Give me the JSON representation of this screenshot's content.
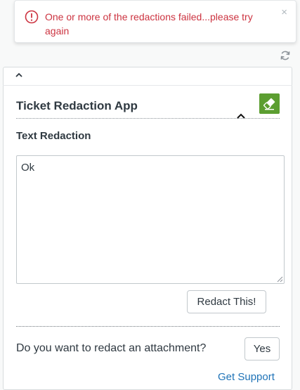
{
  "toast": {
    "message": "One or more of the redactions failed...please try again",
    "icon": "error-circle-icon",
    "close_glyph": "×",
    "color": "#cc3340"
  },
  "app": {
    "title": "Ticket Redaction App",
    "logo_icon": "eraser-icon",
    "logo_color": "#5c9e31"
  },
  "text_redaction": {
    "label": "Text Redaction",
    "value": "Ok",
    "button_label": "Redact This!"
  },
  "attachment": {
    "question": "Do you want to redact an attachment?",
    "button_label": "Yes"
  },
  "footer": {
    "support_link": "Get Support",
    "link_color": "#1f73b7"
  }
}
